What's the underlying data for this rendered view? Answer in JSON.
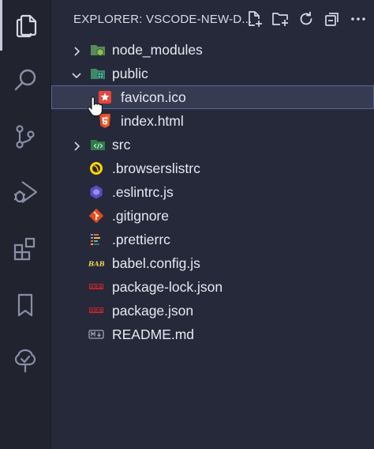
{
  "explorer": {
    "title": "EXPLORER: VSCODE-NEW-D...",
    "actions": [
      {
        "name": "new-file",
        "icon": "new-file-icon"
      },
      {
        "name": "new-folder",
        "icon": "new-folder-icon"
      },
      {
        "name": "refresh",
        "icon": "refresh-icon"
      },
      {
        "name": "collapse-all",
        "icon": "collapse-all-icon"
      },
      {
        "name": "more-actions",
        "icon": "ellipsis-icon"
      }
    ]
  },
  "activity_bar": {
    "items": [
      {
        "name": "explorer",
        "icon": "files-icon",
        "active": true
      },
      {
        "name": "search",
        "icon": "search-icon"
      },
      {
        "name": "source-control",
        "icon": "source-control-icon"
      },
      {
        "name": "run-and-debug",
        "icon": "run-debug-icon"
      },
      {
        "name": "extensions",
        "icon": "extensions-icon"
      },
      {
        "name": "bookmarks",
        "icon": "bookmark-icon"
      },
      {
        "name": "tree-view",
        "icon": "tree-icon"
      }
    ]
  },
  "tree": {
    "items": [
      {
        "label": "node_modules",
        "type": "folder",
        "expanded": false,
        "icon": "folder-node-icon"
      },
      {
        "label": "public",
        "type": "folder",
        "expanded": true,
        "icon": "folder-public-icon"
      },
      {
        "label": "favicon.ico",
        "type": "file",
        "icon": "favicon-icon",
        "selected": true
      },
      {
        "label": "index.html",
        "type": "file",
        "icon": "html5-icon"
      },
      {
        "label": "src",
        "type": "folder",
        "expanded": false,
        "icon": "folder-src-icon"
      },
      {
        "label": ".browserslistrc",
        "type": "file",
        "icon": "browserslist-icon"
      },
      {
        "label": ".eslintrc.js",
        "type": "file",
        "icon": "eslint-icon"
      },
      {
        "label": ".gitignore",
        "type": "file",
        "icon": "git-icon"
      },
      {
        "label": ".prettierrc",
        "type": "file",
        "icon": "prettier-icon"
      },
      {
        "label": "babel.config.js",
        "type": "file",
        "icon": "babel-icon"
      },
      {
        "label": "package-lock.json",
        "type": "file",
        "icon": "npm-icon"
      },
      {
        "label": "package.json",
        "type": "file",
        "icon": "npm-icon"
      },
      {
        "label": "README.md",
        "type": "file",
        "icon": "markdown-icon"
      }
    ]
  },
  "colors": {
    "background": "#262939",
    "activity_bar": "#21242f",
    "selection": "#373b51",
    "selection_border": "#5a6699"
  }
}
